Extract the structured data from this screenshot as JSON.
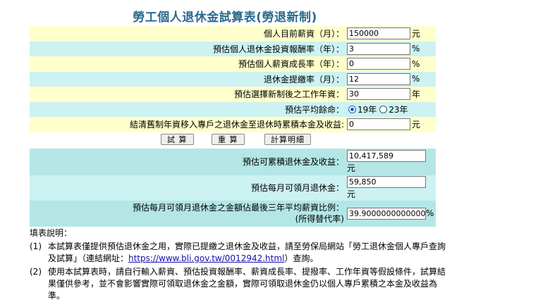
{
  "title": "勞工個人退休金試算表(勞退新制)",
  "fields": [
    {
      "label": "個人目前薪資（月）：",
      "value": "150000",
      "unit": "元"
    },
    {
      "label": "預估個人退休金投資報酬率（年）：",
      "value": "3",
      "unit": "%"
    },
    {
      "label": "預估個人薪資成長率（年）：",
      "value": "0",
      "unit": "%"
    },
    {
      "label": "退休金提繳率（月）：",
      "value": "12",
      "unit": "%"
    },
    {
      "label": "預估選擇新制後之工作年資：",
      "value": "30",
      "unit": "年"
    }
  ],
  "life": {
    "label": "預估平均餘命：",
    "option1": "19年",
    "option2": "23年",
    "selected": "19年"
  },
  "old_transfer": {
    "label": "結清舊制年資移入專戶之退休金至退休時累積本金及收益:",
    "value": "0",
    "unit": "元"
  },
  "buttons": {
    "calc": "試 算",
    "reset": "重 算",
    "explain": "計算明細"
  },
  "results": {
    "total_label": "預估可累積退休金及收益：",
    "total_value": "10,417,589",
    "total_unit": "元",
    "monthly_label": "預估每月可領月退休金：",
    "monthly_value": "59,850",
    "monthly_unit": "元",
    "ratio_label_1": "預估每月可領月退休金之金額佔最後三年平均薪資比例：",
    "ratio_label_2": "(所得替代率)",
    "ratio_value": "39.90000000000000",
    "ratio_unit": "%"
  },
  "notes": {
    "heading": "填表說明：",
    "n1_num": "(1)",
    "n1_text_a": "本試算表僅提供預估退休金之用，實際已提繳之退休金及收益，請至勞保局網站「勞工退休金個人專戶查詢及試算」（連結網址：",
    "n1_link": "https://www.bli.gov.tw/0012942.html",
    "n1_text_b": "）查詢。",
    "n2_num": "(2)",
    "n2_text": "使用本試算表時，請自行輸入薪資、預估投資報酬率、薪資成長率、提撥率、工作年資等假設條件，試算結果僅供參考，並不會影響實際可領取退休金之金額，實際可領取退休金仍以個人專戶累積之本金及收益為準。"
  }
}
